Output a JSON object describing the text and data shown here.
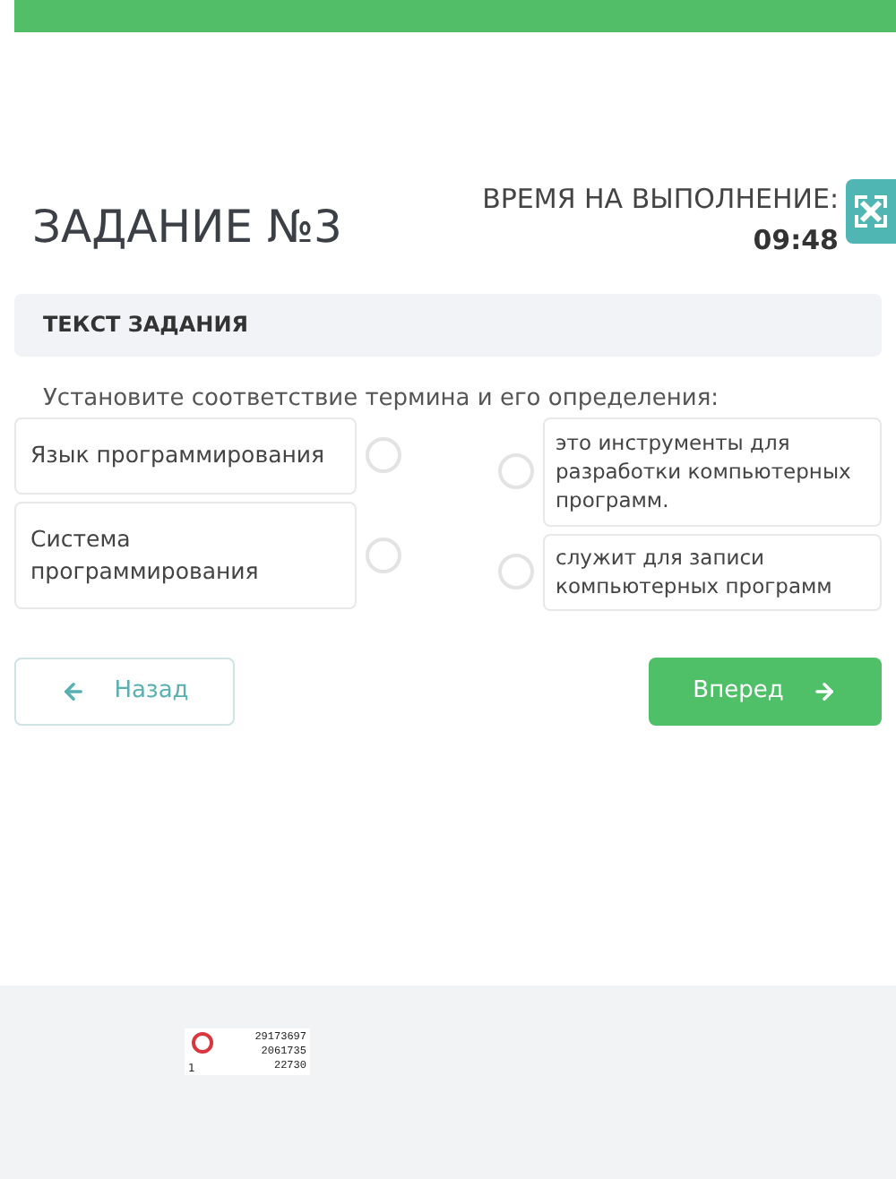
{
  "task": {
    "title": "ЗАДАНИЕ №3",
    "timer_label": "ВРЕМЯ НА ВЫПОЛНЕНИЕ:",
    "timer_value": "09:48"
  },
  "section": {
    "header": "ТЕКСТ ЗАДАНИЯ",
    "instruction": "Установите соответствие термина и его определения:"
  },
  "terms": [
    {
      "text": "Язык программирования",
      "selected": false
    },
    {
      "text": "Система программирования",
      "selected": false
    }
  ],
  "definitions": [
    {
      "text": "это инструменты для разработки компьютерных программ.",
      "selected": false
    },
    {
      "text": "служит для записи компьютерных программ",
      "selected": false
    }
  ],
  "buttons": {
    "back": "Назад",
    "next": "Вперед"
  },
  "counter": {
    "lines": [
      "29173697",
      "2061735",
      "22730"
    ],
    "index": "1"
  }
}
